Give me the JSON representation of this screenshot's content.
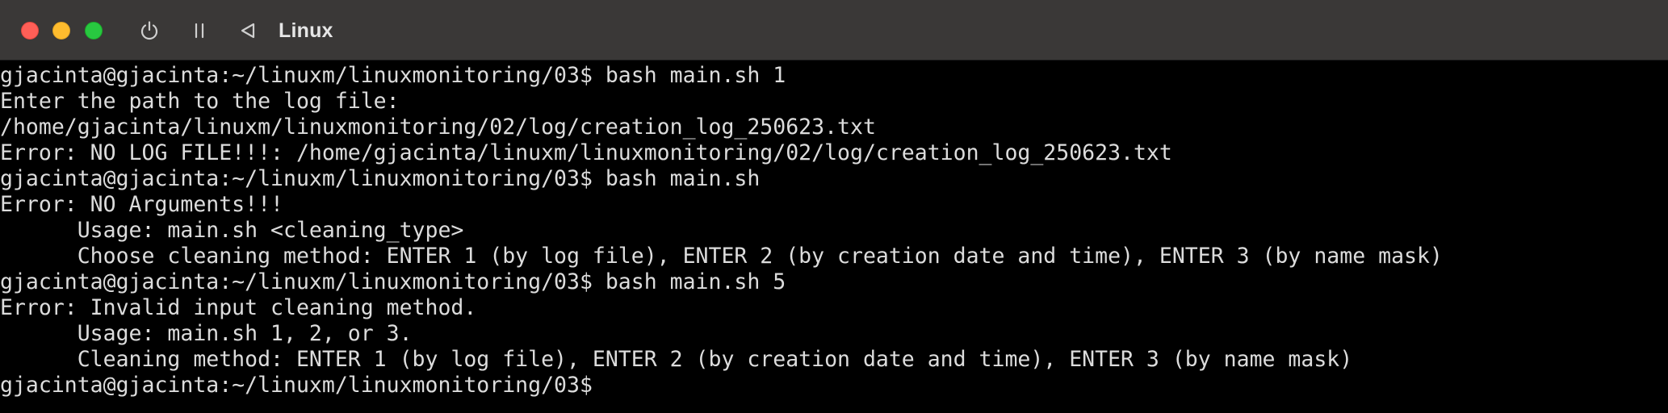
{
  "window": {
    "title": "Linux",
    "controls": {
      "close": "close-button",
      "minimize": "minimize-button",
      "zoom": "zoom-button"
    },
    "toolbar_icons": [
      "power-icon",
      "pause-icon",
      "back-icon"
    ]
  },
  "colors": {
    "titlebar": "#3a3837",
    "terminal_bg": "#000000",
    "terminal_fg": "#dcdcdc",
    "close": "#ff5f57",
    "minimize": "#febc2e",
    "zoom": "#28c840"
  },
  "terminal": {
    "lines": [
      "gjacinta@gjacinta:~/linuxm/linuxmonitoring/03$ bash main.sh 1",
      "Enter the path to the log file:",
      "/home/gjacinta/linuxm/linuxmonitoring/02/log/creation_log_250623.txt",
      "Error: NO LOG FILE!!!: /home/gjacinta/linuxm/linuxmonitoring/02/log/creation_log_250623.txt",
      "gjacinta@gjacinta:~/linuxm/linuxmonitoring/03$ bash main.sh",
      "Error: NO Arguments!!!",
      "      Usage: main.sh <cleaning_type>",
      "      Choose cleaning method: ENTER 1 (by log file), ENTER 2 (by creation date and time), ENTER 3 (by name mask)",
      "gjacinta@gjacinta:~/linuxm/linuxmonitoring/03$ bash main.sh 5",
      "Error: Invalid input cleaning method.",
      "      Usage: main.sh 1, 2, or 3.",
      "      Cleaning method: ENTER 1 (by log file), ENTER 2 (by creation date and time), ENTER 3 (by name mask)",
      "gjacinta@gjacinta:~/linuxm/linuxmonitoring/03$ "
    ]
  }
}
